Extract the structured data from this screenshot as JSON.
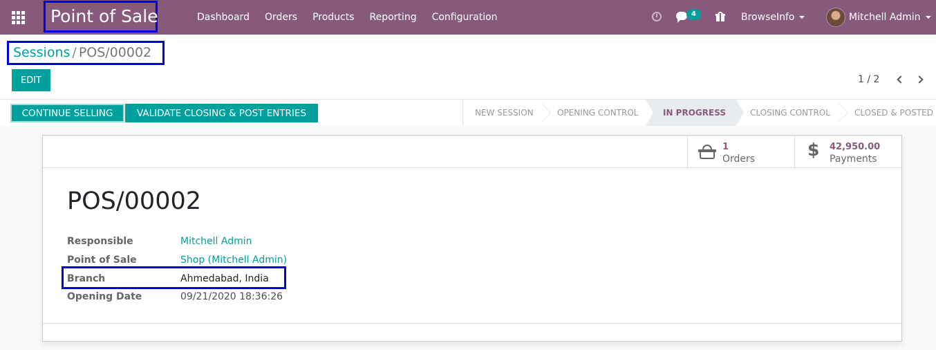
{
  "app": {
    "title": "Point of Sale"
  },
  "menu": [
    "Dashboard",
    "Orders",
    "Products",
    "Reporting",
    "Configuration"
  ],
  "systray": {
    "messages_count": "4",
    "company": "BrowseInfo",
    "user": "Mitchell Admin"
  },
  "breadcrumb": {
    "parent": "Sessions",
    "separator": "/",
    "current": "POS/00002"
  },
  "toolbar": {
    "edit_label": "EDIT"
  },
  "pager": {
    "value": "1 / 2"
  },
  "actions": {
    "continue_label": "CONTINUE SELLING",
    "validate_label": "VALIDATE CLOSING & POST ENTRIES"
  },
  "stages": {
    "new": "NEW SESSION",
    "opening": "OPENING CONTROL",
    "progress": "IN PROGRESS",
    "closing": "CLOSING CONTROL",
    "closed": "CLOSED & POSTED",
    "active": "IN PROGRESS"
  },
  "stat_buttons": {
    "orders": {
      "value": "1",
      "label": "Orders",
      "icon": "basket-icon"
    },
    "payments": {
      "value": "42,950.00",
      "label": "Payments",
      "icon": "dollar-icon"
    }
  },
  "record": {
    "name": "POS/00002",
    "fields": {
      "responsible": {
        "label": "Responsible",
        "value": "Mitchell Admin"
      },
      "point_of_sale": {
        "label": "Point of Sale",
        "value": "Shop (Mitchell Admin)"
      },
      "branch": {
        "label": "Branch",
        "value": "Ahmedabad, India"
      },
      "opening_date": {
        "label": "Opening Date",
        "value": "09/21/2020 18:36:26"
      }
    }
  },
  "colors": {
    "navbar": "#875a7b",
    "primary": "#00a09d",
    "highlight_box": "#0000e6"
  }
}
